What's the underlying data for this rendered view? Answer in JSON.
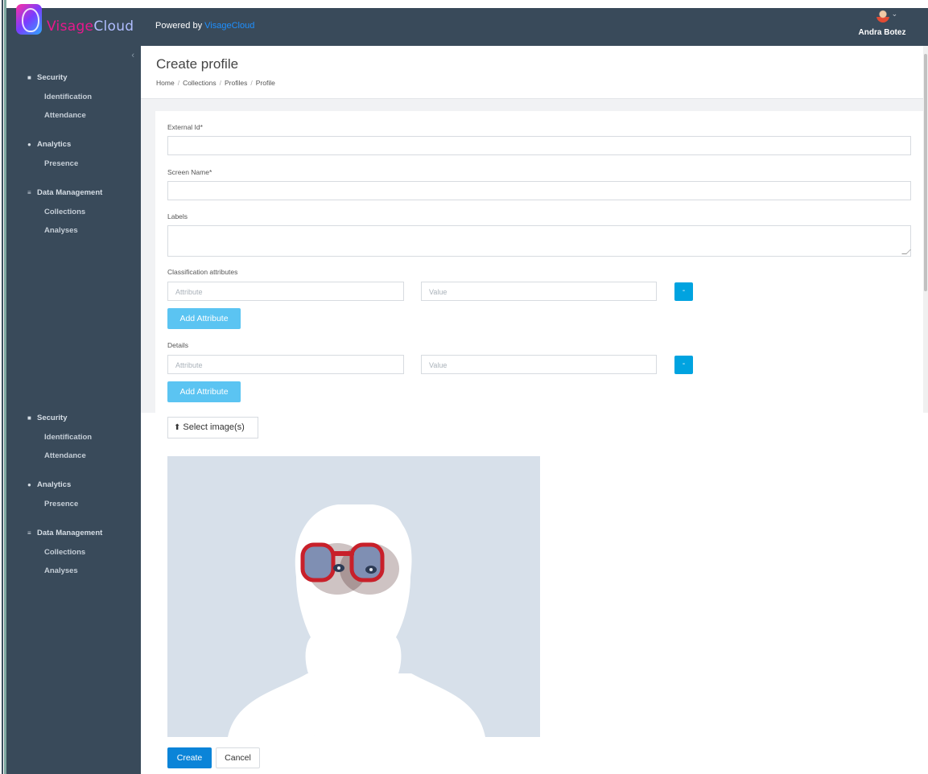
{
  "header": {
    "brand_part1": "Visage",
    "brand_part2": "Cloud",
    "powered_prefix": "Powered by ",
    "powered_link": "VisageCloud",
    "user_name": "Andra Botez"
  },
  "sidebar": {
    "collapse_glyph": "‹",
    "groups": [
      {
        "label": "Security",
        "icon": "video-camera-icon",
        "items": [
          "Identification",
          "Attendance"
        ]
      },
      {
        "label": "Analytics",
        "icon": "pie-chart-icon",
        "items": [
          "Presence"
        ]
      },
      {
        "label": "Data Management",
        "icon": "list-icon",
        "items": [
          "Collections",
          "Analyses"
        ]
      }
    ],
    "groups_repeat": [
      {
        "label": "Security",
        "items": [
          "Identification",
          "Attendance"
        ]
      },
      {
        "label": "Analytics",
        "items": [
          "Presence"
        ]
      },
      {
        "label": "Data Management",
        "items": [
          "Collections",
          "Analyses"
        ]
      }
    ]
  },
  "page": {
    "title": "Create profile",
    "breadcrumb": [
      "Home",
      "Collections",
      "Profiles",
      "Profile"
    ]
  },
  "form": {
    "external_id_label": "External Id*",
    "screen_name_label": "Screen Name*",
    "labels_label": "Labels",
    "classification_label": "Classification attributes",
    "attribute_placeholder": "Attribute",
    "value_placeholder": "Value",
    "remove_label": "-",
    "add_attribute_label": "Add Attribute",
    "details_label": "Details",
    "select_images_label": "Select image(s)",
    "create_label": "Create",
    "cancel_label": "Cancel"
  },
  "colors": {
    "topbar": "#394a5a",
    "sidebar": "#394a5a",
    "accent": "#00a3e0",
    "brand_pink": "#e8188c",
    "create_button": "#0b84d8"
  }
}
